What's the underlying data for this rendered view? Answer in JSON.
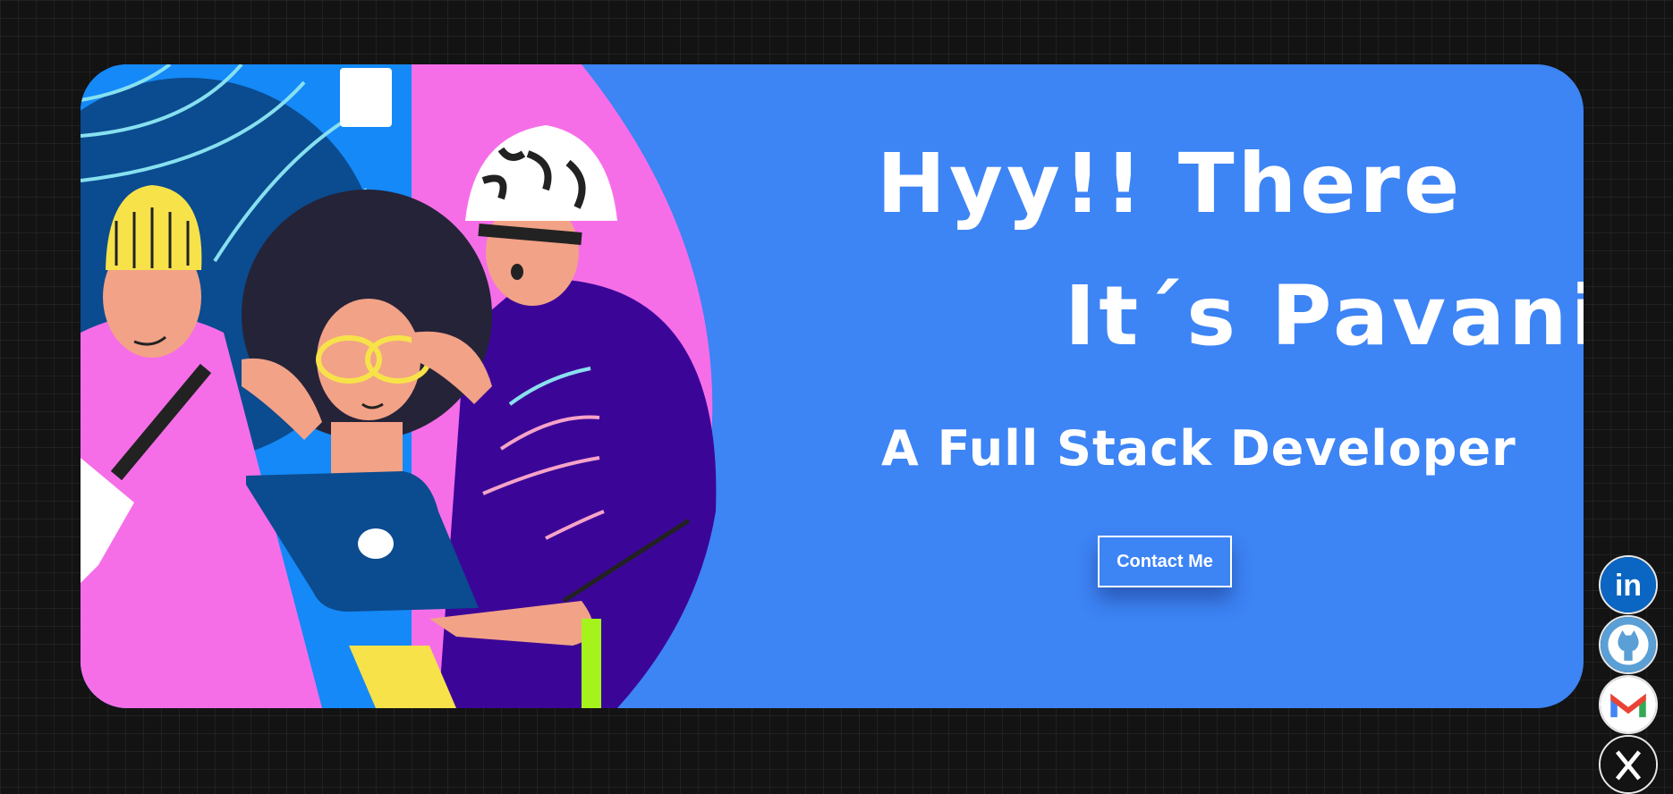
{
  "hero": {
    "greeting": "Hyy!! There",
    "name_line": "It´s Pavani",
    "tagline": "A Full Stack Developer",
    "contact_button": "Contact Me",
    "background_color": "#3d84f5"
  },
  "social_links": [
    {
      "name": "linkedin",
      "icon": "linkedin-icon",
      "text": "in"
    },
    {
      "name": "github",
      "icon": "github-icon"
    },
    {
      "name": "gmail",
      "icon": "gmail-icon",
      "text": "M"
    },
    {
      "name": "x",
      "icon": "x-icon"
    }
  ],
  "colors": {
    "page_background": "#131313",
    "accent_pink": "#f56ee8",
    "accent_purple": "#3b0698",
    "accent_navy": "#0b4b8f"
  }
}
